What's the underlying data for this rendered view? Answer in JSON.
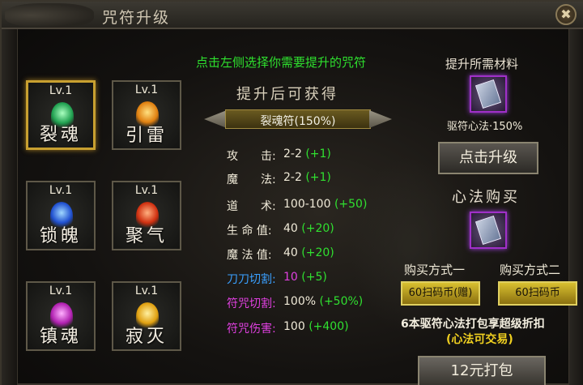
{
  "window": {
    "title": "咒符升级",
    "close_label": "✖"
  },
  "hint": "点击左侧选择你需要提升的咒符",
  "obtain_title": "提升后可获得",
  "selected_bar": "裂魂符(150%)",
  "talismans": [
    {
      "level": "Lv.1",
      "name": "裂魂",
      "color": "green",
      "selected": true
    },
    {
      "level": "Lv.1",
      "name": "引雷",
      "color": "gold",
      "selected": false
    },
    {
      "level": "Lv.1",
      "name": "锁魄",
      "color": "blue",
      "selected": false
    },
    {
      "level": "Lv.1",
      "name": "聚气",
      "color": "red",
      "selected": false
    },
    {
      "level": "Lv.1",
      "name": "镇魂",
      "color": "purple",
      "selected": false
    },
    {
      "level": "Lv.1",
      "name": "寂灭",
      "color": "yellow",
      "selected": false
    }
  ],
  "stats": [
    {
      "key": "攻　　击:",
      "value": "2-2",
      "bonus": "(+1)",
      "key_color": "#f0ead8",
      "value_color": "#f0ead8"
    },
    {
      "key": "魔　　法:",
      "value": "2-2",
      "bonus": "(+1)",
      "key_color": "#f0ead8",
      "value_color": "#f0ead8"
    },
    {
      "key": "道　　术:",
      "value": "100-100",
      "bonus": "(+50)",
      "key_color": "#f0ead8",
      "value_color": "#f0ead8"
    },
    {
      "key": "生 命 值:",
      "value": "40",
      "bonus": "(+20)",
      "key_color": "#f0ead8",
      "value_color": "#f0ead8"
    },
    {
      "key": "魔 法 值:",
      "value": "40",
      "bonus": "(+20)",
      "key_color": "#f0ead8",
      "value_color": "#f0ead8"
    },
    {
      "key": "刀刀切割:",
      "value": "10",
      "bonus": "(+5)",
      "key_color": "#3aa0ff",
      "value_color": "#e040e0"
    },
    {
      "key": "符咒切割:",
      "value": "100%",
      "bonus": "(+50%)",
      "key_color": "#e040e0",
      "value_color": "#f0ead8"
    },
    {
      "key": "符咒伤害:",
      "value": "100",
      "bonus": "(+400)",
      "key_color": "#e040e0",
      "value_color": "#f0ead8"
    }
  ],
  "materials": {
    "title": "提升所需材料",
    "item_label": "驱符心法·150%",
    "icon": "book-icon"
  },
  "upgrade_button": "点击升级",
  "heart_method_title": "心法购买",
  "buy": {
    "option1_label": "购买方式一",
    "option2_label": "购买方式二",
    "option1_button": "60扫码币(赠)",
    "option2_button": "60扫码币"
  },
  "deal_line1": "6本驱符心法打包享超级折扣",
  "deal_line2": "(心法可交易)",
  "pack_button": "12元打包"
}
